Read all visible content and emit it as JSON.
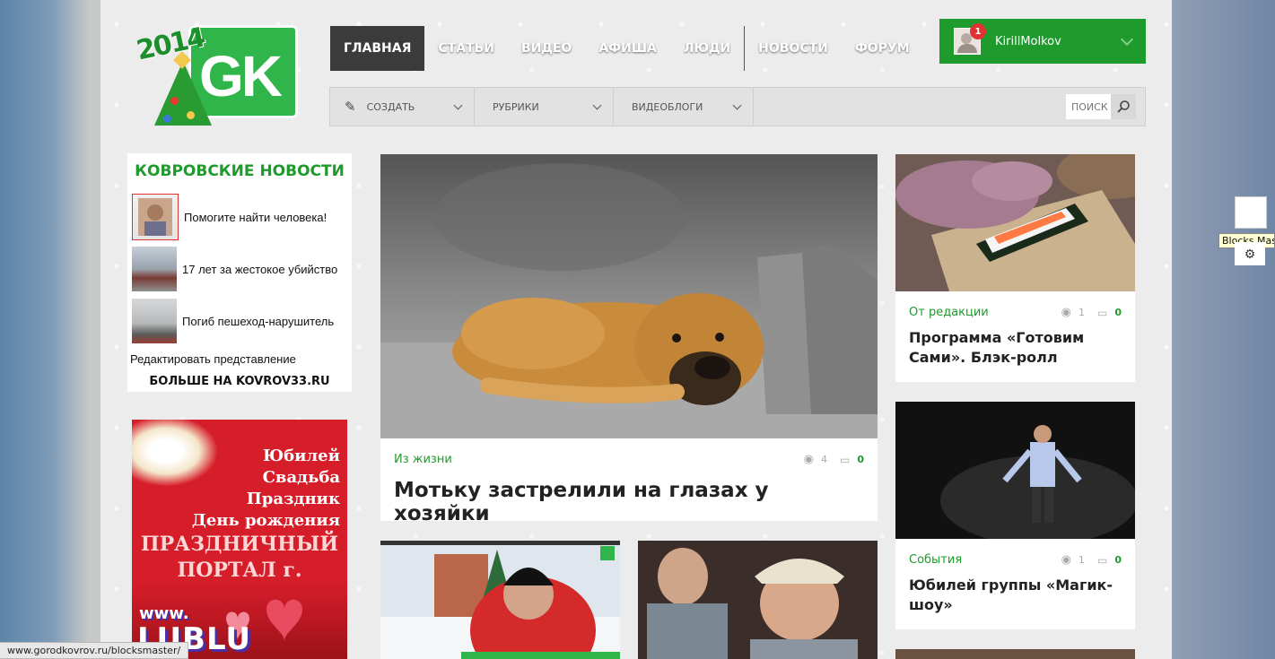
{
  "nav": {
    "items": [
      "ГЛАВНАЯ",
      "СТАТЬИ",
      "ВИДЕО",
      "АФИША",
      "ЛЮДИ",
      "НОВОСТИ",
      "ФОРУМ"
    ]
  },
  "logo": {
    "year": "2014",
    "text": "GK"
  },
  "user": {
    "name": "KirillMolkov",
    "badge": "1"
  },
  "subnav": {
    "create": "СОЗДАТЬ",
    "rubrics": "РУБРИКИ",
    "videoblogs": "ВИДЕОБЛОГИ",
    "search_placeholder": "ПОИСК"
  },
  "news_widget": {
    "title": "КОВРОВСКИЕ НОВОСТИ",
    "items": [
      "Помогите найти человека!",
      "17 лет за жестокое убийство",
      "Погиб пешеход-нарушитель"
    ],
    "edit": "Редактировать представление",
    "more": "БОЛЬШЕ НА KOVROV33.RU"
  },
  "ad": {
    "lines": [
      "Юбилей",
      "Свадьба",
      "Праздник",
      "День рождения"
    ],
    "portal1": "ПРАЗДНИЧНЫЙ",
    "portal2": "ПОРТАЛ г. Ковров",
    "www": "www.",
    "site": "LUBLU"
  },
  "featured": {
    "category": "Из жизни",
    "views": "4",
    "comments": "0",
    "title": "Мотьку застрелили на глазах у хозяйки"
  },
  "cards": [
    {
      "category": "От редакции",
      "views": "1",
      "comments": "0",
      "title": "Программа «Готовим Сами». Блэк-ролл"
    },
    {
      "category": "События",
      "views": "1",
      "comments": "0",
      "title": "Юбилей группы «Магик-шоу»"
    }
  ],
  "status_url": "www.gorodkovrov.ru/blocksmaster/",
  "blocks_tooltip": "Blocks Master"
}
